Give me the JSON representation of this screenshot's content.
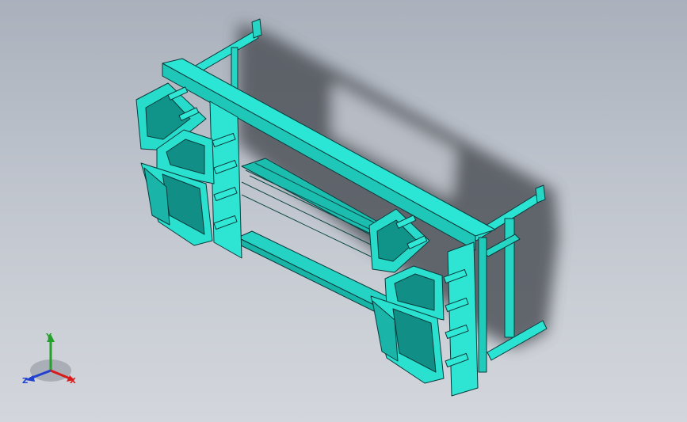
{
  "viewport": {
    "background_top": "#aab1bc",
    "background_bottom": "#d3d6dc",
    "model_color": "#22e0cf",
    "edge_color": "#0b3a3a",
    "shadow_color": "#4a4d52"
  },
  "triad": {
    "x_label": "X",
    "y_label": "Y",
    "z_label": "Z",
    "x_color": "#d81c1c",
    "y_color": "#23a12b",
    "z_color": "#2040d0"
  }
}
